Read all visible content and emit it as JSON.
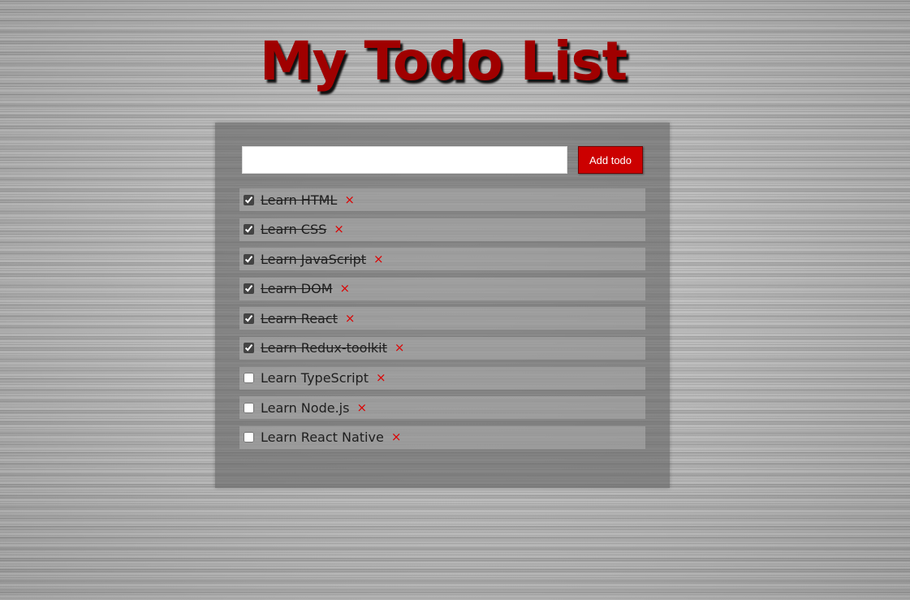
{
  "header": {
    "title": "My Todo List"
  },
  "form": {
    "input_value": "",
    "input_placeholder": "",
    "add_label": "Add todo"
  },
  "colors": {
    "accent": "#cc0000",
    "title": "#a00000",
    "delete": "#dd0000"
  },
  "todos": [
    {
      "text": "Learn HTML",
      "done": true
    },
    {
      "text": "Learn CSS",
      "done": true
    },
    {
      "text": "Learn JavaScript",
      "done": true
    },
    {
      "text": "Learn DOM",
      "done": true
    },
    {
      "text": "Learn React",
      "done": true
    },
    {
      "text": "Learn Redux-toolkit",
      "done": true
    },
    {
      "text": "Learn TypeScript",
      "done": false
    },
    {
      "text": "Learn Node.js",
      "done": false
    },
    {
      "text": "Learn React Native",
      "done": false
    }
  ],
  "delete_glyph": "×"
}
